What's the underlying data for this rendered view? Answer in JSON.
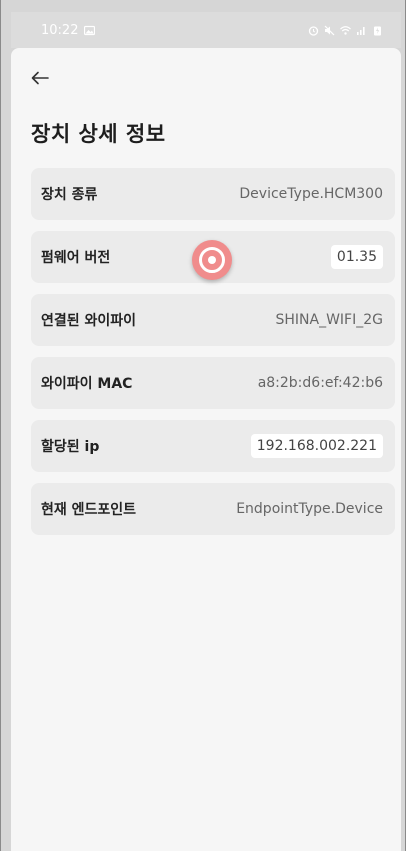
{
  "status_bar": {
    "time": "10:22",
    "left_icons": [
      "image-icon"
    ],
    "right_icons": [
      "alarm-icon",
      "mute-icon",
      "wifi-icon",
      "signal-icon",
      "battery-charging-icon"
    ]
  },
  "page": {
    "back_icon": "arrow-left-icon",
    "title": "장치 상세 정보"
  },
  "rows": [
    {
      "label": "장치 종류",
      "value": "DeviceType.HCM300"
    },
    {
      "label": "펌웨어 버전",
      "value": "01.35"
    },
    {
      "label": "연결된 와이파이",
      "value": "SHINA_WIFI_2G"
    },
    {
      "label": "와이파이 MAC",
      "value": "a8:2b:d6:ef:42:b6"
    },
    {
      "label": "할당된 ip",
      "value": "192.168.002.221"
    },
    {
      "label": "현재 엔드포인트",
      "value": "EndpointType.Device"
    }
  ],
  "colors": {
    "tap_indicator": "#f08c8c",
    "row_background": "#ebebeb",
    "screen_background": "#f6f6f6"
  }
}
